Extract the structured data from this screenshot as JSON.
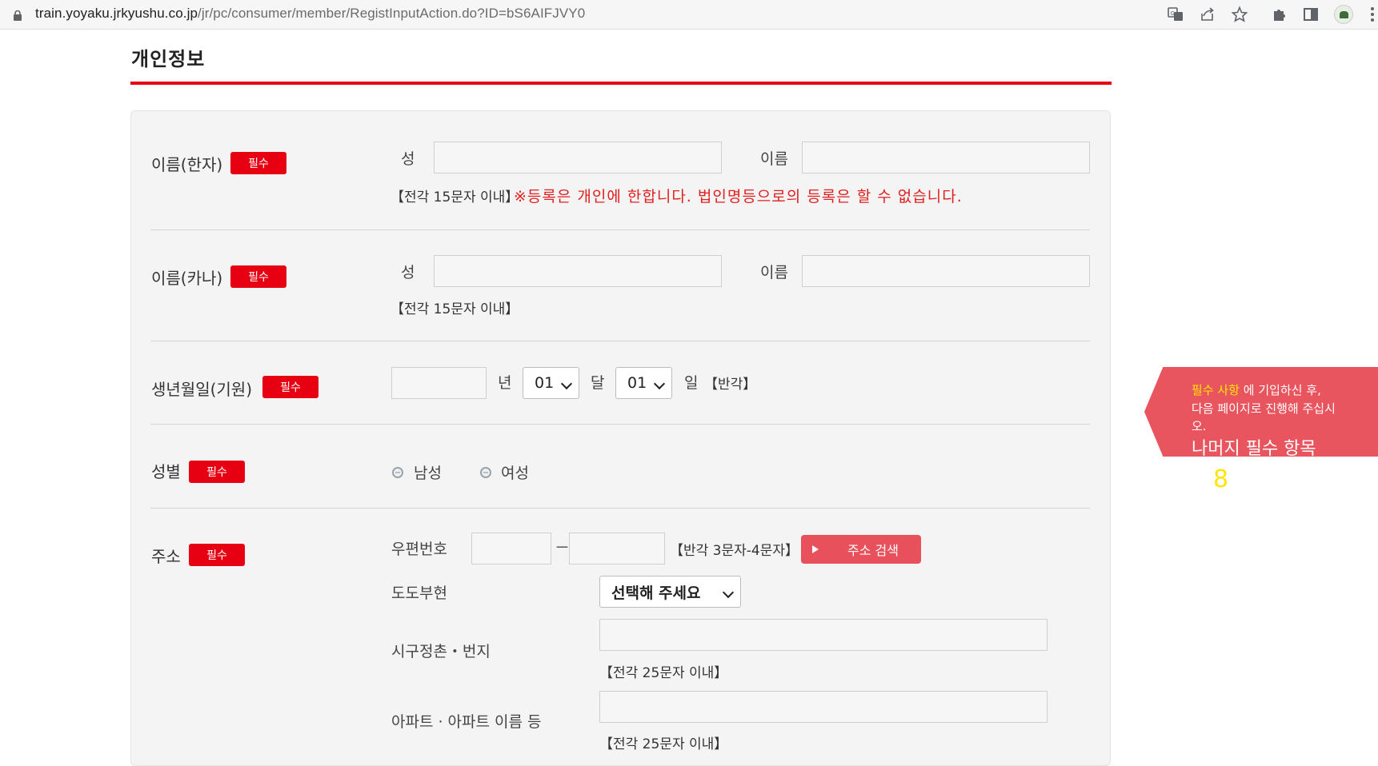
{
  "browser": {
    "url_host": "train.yoyaku.jrkyushu.co.jp",
    "url_path": "/jr/pc/consumer/member/RegistInputAction.do?ID=bS6AIFJVY0"
  },
  "page": {
    "title": "개인정보"
  },
  "form": {
    "required_badge": "필수",
    "name_kanji": {
      "label": "이름(한자)",
      "surname_label": "성",
      "given_label": "이름",
      "note": "【전각 15문자 이내】",
      "warning": "※등록은 개인에 한합니다. 법인명등으로의 등록은 할 수 없습니다."
    },
    "name_kana": {
      "label": "이름(카나)",
      "surname_label": "성",
      "given_label": "이름",
      "note": "【전각 15문자 이내】"
    },
    "birthdate": {
      "label": "생년월일(기원)",
      "year_unit": "년",
      "month_value": "01",
      "month_unit": "달",
      "day_value": "01",
      "day_unit": "일",
      "note": "【반각】"
    },
    "gender": {
      "label": "성별",
      "male": "남성",
      "female": "여성"
    },
    "address": {
      "label": "주소",
      "postal_label": "우편번호",
      "postal_sep": "－",
      "postal_note": "【반각 3문자-4문자】",
      "search_button": "주소 검색",
      "prefecture_label": "도도부현",
      "prefecture_value": "선택해 주세요",
      "city_label": "시구정촌・번지",
      "city_note": "【전각 25문자 이내】",
      "apartment_label": "아파트 · 아파트 이름 등",
      "apartment_note": "【전각 25문자 이내】"
    }
  },
  "tooltip": {
    "line1_highlight": "필수 사항",
    "line1_rest": "에 기입하신 후,",
    "line2": "다음 페이지로 진행해 주십시",
    "line3": "오.",
    "remaining_label": "나머지 필수 항목",
    "remaining_count": "8"
  }
}
